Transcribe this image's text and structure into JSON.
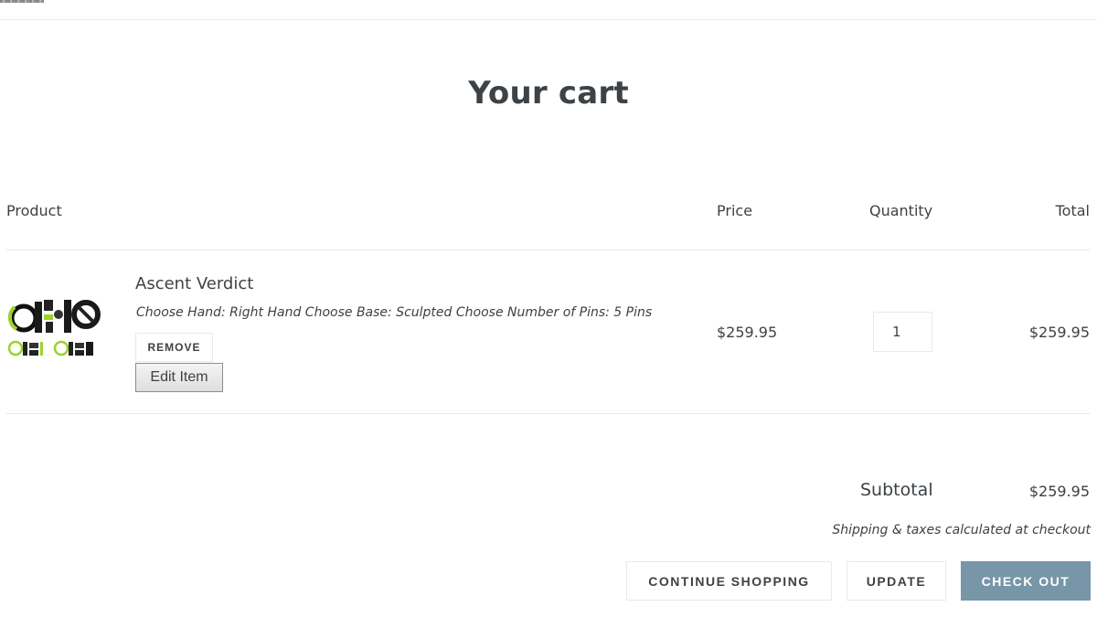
{
  "page": {
    "title": "Your cart"
  },
  "table": {
    "columns": [
      "Product",
      "Price",
      "Quantity",
      "Total"
    ]
  },
  "cart": {
    "items": [
      {
        "title": "Ascent Verdict",
        "options": "Choose Hand: Right Hand Choose Base: Sculpted Choose Number of Pins: 5 Pins",
        "remove_label": "REMOVE",
        "edit_label": "Edit Item",
        "price": "$259.95",
        "quantity": "1",
        "total": "$259.95",
        "image_icon": "product-sight-image"
      }
    ]
  },
  "summary": {
    "subtotal_label": "Subtotal",
    "subtotal_value": "$259.95",
    "shipping_note": "Shipping & taxes calculated at checkout"
  },
  "actions": {
    "continue_label": "CONTINUE SHOPPING",
    "update_label": "UPDATE",
    "checkout_label": "CHECK OUT"
  },
  "colors": {
    "text": "#3d4246",
    "border": "#e8e9eb",
    "checkout_bg": "#7796a8",
    "accent_green": "#9bd32a"
  }
}
